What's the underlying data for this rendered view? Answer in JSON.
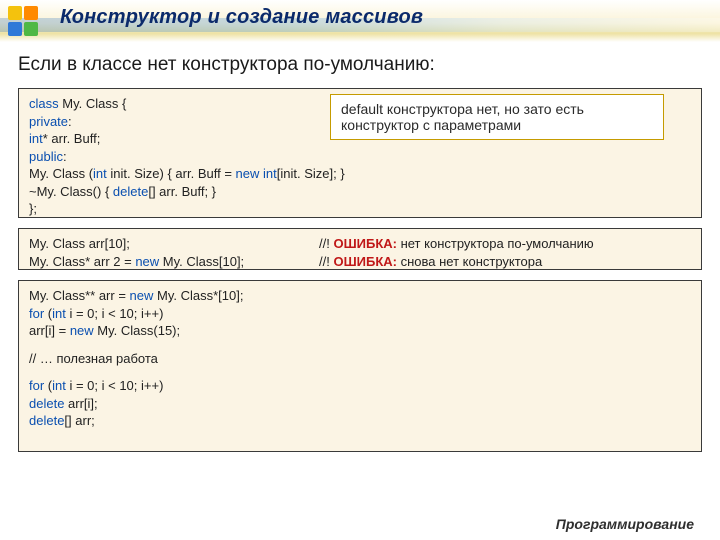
{
  "title": "Конструктор и создание массивов",
  "intro": "Если в классе нет конструктора по-умолчанию:",
  "callout": {
    "line1": "default конструктора нет, но зато есть",
    "line2": "конструктор с параметрами"
  },
  "box1": {
    "l1a": "class",
    "l1b": " My. Class {",
    "l2": "private",
    "l3a": "   ",
    "l3b": "int",
    "l3c": "* arr. Buff;",
    "l4": "public",
    "l5a": "   My. Class (",
    "l5b": "int",
    "l5c": " init. Size) { arr. Buff = ",
    "l5d": "new int",
    "l5e": "[init. Size]; }",
    "l6a": "   ~My. Class() { ",
    "l6b": "delete",
    "l6c": "[] arr. Buff; }",
    "l7": "};"
  },
  "box2": {
    "l1": "My. Class arr[10];",
    "l2a": "My. Class* arr 2 = ",
    "l2b": "new",
    "l2c": " My. Class[10];",
    "c1a": "//! ",
    "c1b": "ОШИБКА:",
    "c1c": " нет конструктора по-умолчанию",
    "c2a": "//! ",
    "c2b": "ОШИБКА:",
    "c2c": " снова нет конструктора"
  },
  "box3": {
    "l1a": "My. Class** arr = ",
    "l1b": "new",
    "l1c": " My. Class*[10];",
    "l2a": "for",
    "l2b": " (",
    "l2c": "int",
    "l2d": " i = 0; i < 10; i++)",
    "l3a": "   arr[i] = ",
    "l3b": "new",
    "l3c": " My. Class(15);",
    "gap": " ",
    "l4": "// … полезная работа",
    "gap2": " ",
    "l5a": "for",
    "l5b": " (",
    "l5c": "int",
    "l5d": " i = 0; i < 10; i++)",
    "l6a": "   ",
    "l6b": "delete",
    "l6c": " arr[i];",
    "l7a": "delete",
    "l7b": "[] arr;"
  },
  "footer": "Программирование"
}
